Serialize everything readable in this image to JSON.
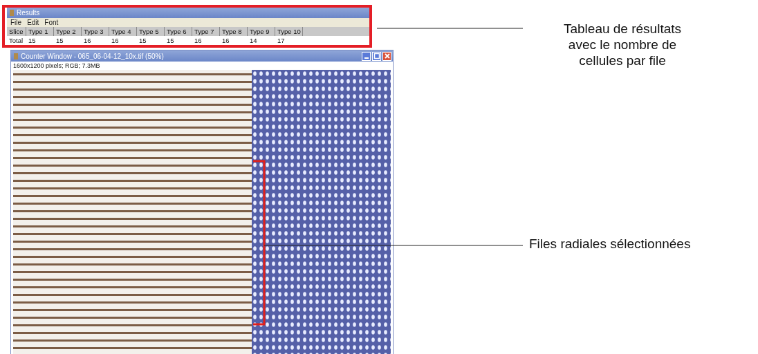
{
  "results_window": {
    "title": "Results",
    "menu": [
      "File",
      "Edit",
      "Font"
    ],
    "table": {
      "columns": [
        "Slice",
        "Type 1",
        "Type 2",
        "Type 3",
        "Type 4",
        "Type 5",
        "Type 6",
        "Type 7",
        "Type 8",
        "Type 9",
        "Type 10"
      ],
      "rows": [
        [
          "Total",
          "15",
          "15",
          "16",
          "16",
          "15",
          "15",
          "16",
          "16",
          "14",
          "17"
        ]
      ]
    }
  },
  "counter_window": {
    "title": "Counter Window - 065_06-04-12_10x.tif (50%)",
    "info": "1600x1200 pixels; RGB; 7.3MB"
  },
  "annotations": [
    {
      "text": "Tableau de résultats\navec le nombre de\ncellules par file"
    },
    {
      "text": "Files radiales sélectionnées"
    }
  ]
}
